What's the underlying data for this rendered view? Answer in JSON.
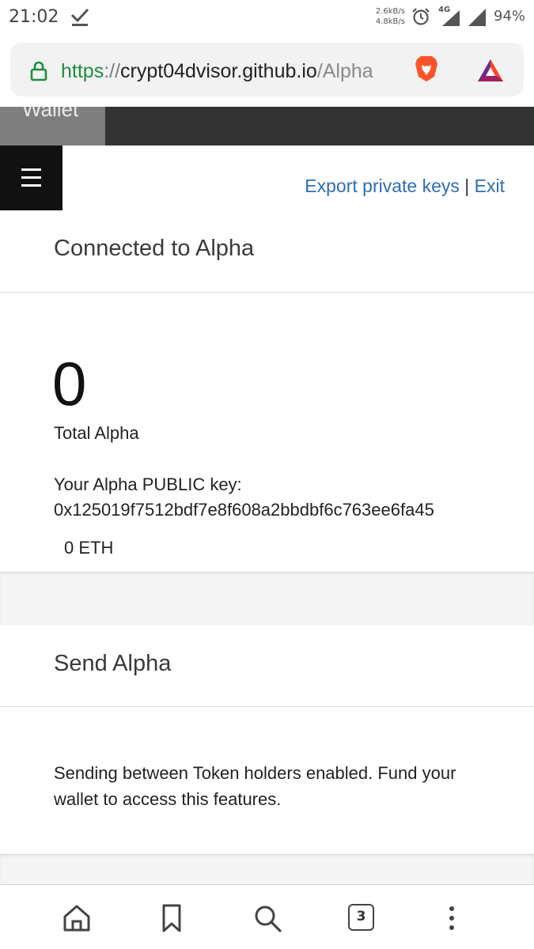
{
  "status_bar": {
    "time": "21:02",
    "net_up": "2.6kB/s",
    "net_down": "4.8kB/s",
    "network": "4G",
    "battery": "94%"
  },
  "browser": {
    "url_scheme": "https",
    "url_sep": "://",
    "url_host": "crypt04dvisor.github.io",
    "url_path": "/Alpha"
  },
  "header": {
    "wallet_tab": "Wallet"
  },
  "links": {
    "export": "Export private keys",
    "separator": "|",
    "exit": "Exit"
  },
  "connected": {
    "title": "Connected to Alpha"
  },
  "balance": {
    "amount": "0",
    "label": "Total Alpha",
    "public_key_label": "Your Alpha PUBLIC key:",
    "public_key": "0x125019f7512bdf7e8f608a2bbdbf6c763ee6fa45",
    "eth": "0 ETH"
  },
  "send": {
    "title": "Send Alpha",
    "message": "Sending between Token holders enabled. Fund your wallet to access this features."
  },
  "bottom_nav": {
    "tabs_count": "3"
  },
  "colors": {
    "link": "#2f6db6",
    "header": "#333333",
    "lock": "#1e8e3e"
  }
}
